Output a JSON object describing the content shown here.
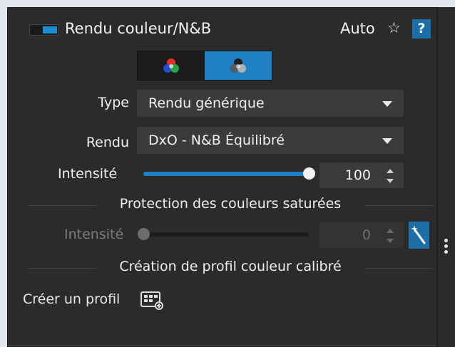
{
  "header": {
    "title": "Rendu couleur/N&B",
    "auto_label": "Auto",
    "star_glyph": "☆",
    "help_label": "?",
    "toggle_on": true,
    "accent_color": "#1e8fd6"
  },
  "mode_toggle": {
    "options": [
      "color-mode-icon",
      "monochrome-mode-icon"
    ],
    "selected": 1
  },
  "type_row": {
    "label": "Type",
    "value": "Rendu générique"
  },
  "rendu_row": {
    "label": "Rendu",
    "value": "DxO - N&B Équilibré"
  },
  "intensity": {
    "label": "Intensité",
    "value": "100",
    "fraction": 1.0
  },
  "saturated_protection": {
    "heading": "Protection des couleurs saturées",
    "label": "Intensité",
    "value": "0",
    "fraction": 0.0,
    "disabled": true
  },
  "calibrated_profile": {
    "heading": "Création de profil couleur calibré",
    "create_label": "Créer un profil"
  }
}
